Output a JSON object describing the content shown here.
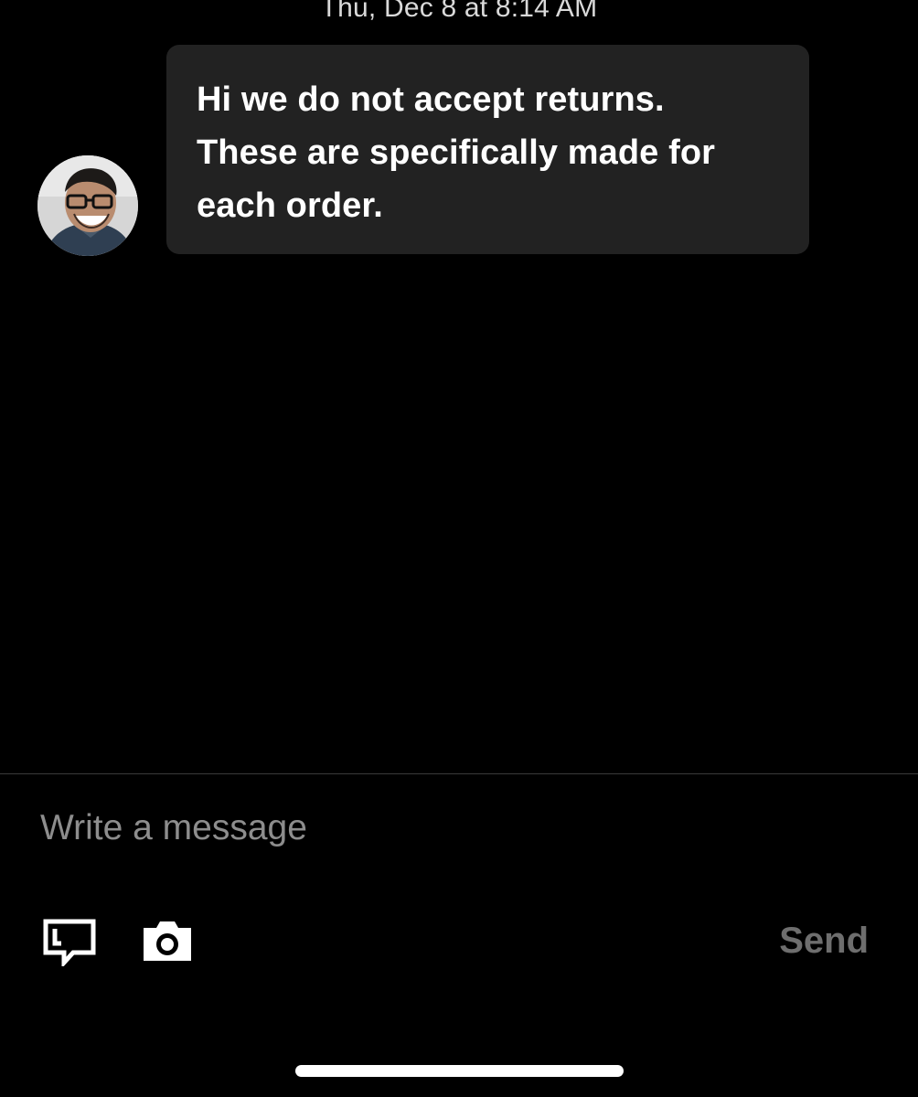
{
  "conversation": {
    "timestamp": "Thu, Dec 8 at 8:14 AM",
    "messages": [
      {
        "text": "Hi we do not accept returns.\nThese are specifically made for\neach order.",
        "avatar_icon": "person-avatar"
      }
    ]
  },
  "composer": {
    "placeholder": "Write a message",
    "value": "",
    "send_label": "Send",
    "send_color": "#6e6e6e",
    "tools": [
      {
        "icon": "saved-reply-icon"
      },
      {
        "icon": "camera-icon"
      }
    ]
  },
  "colors": {
    "background": "#000000",
    "bubble": "#222222",
    "text": "#ffffff",
    "placeholder": "#8d8d8d"
  }
}
